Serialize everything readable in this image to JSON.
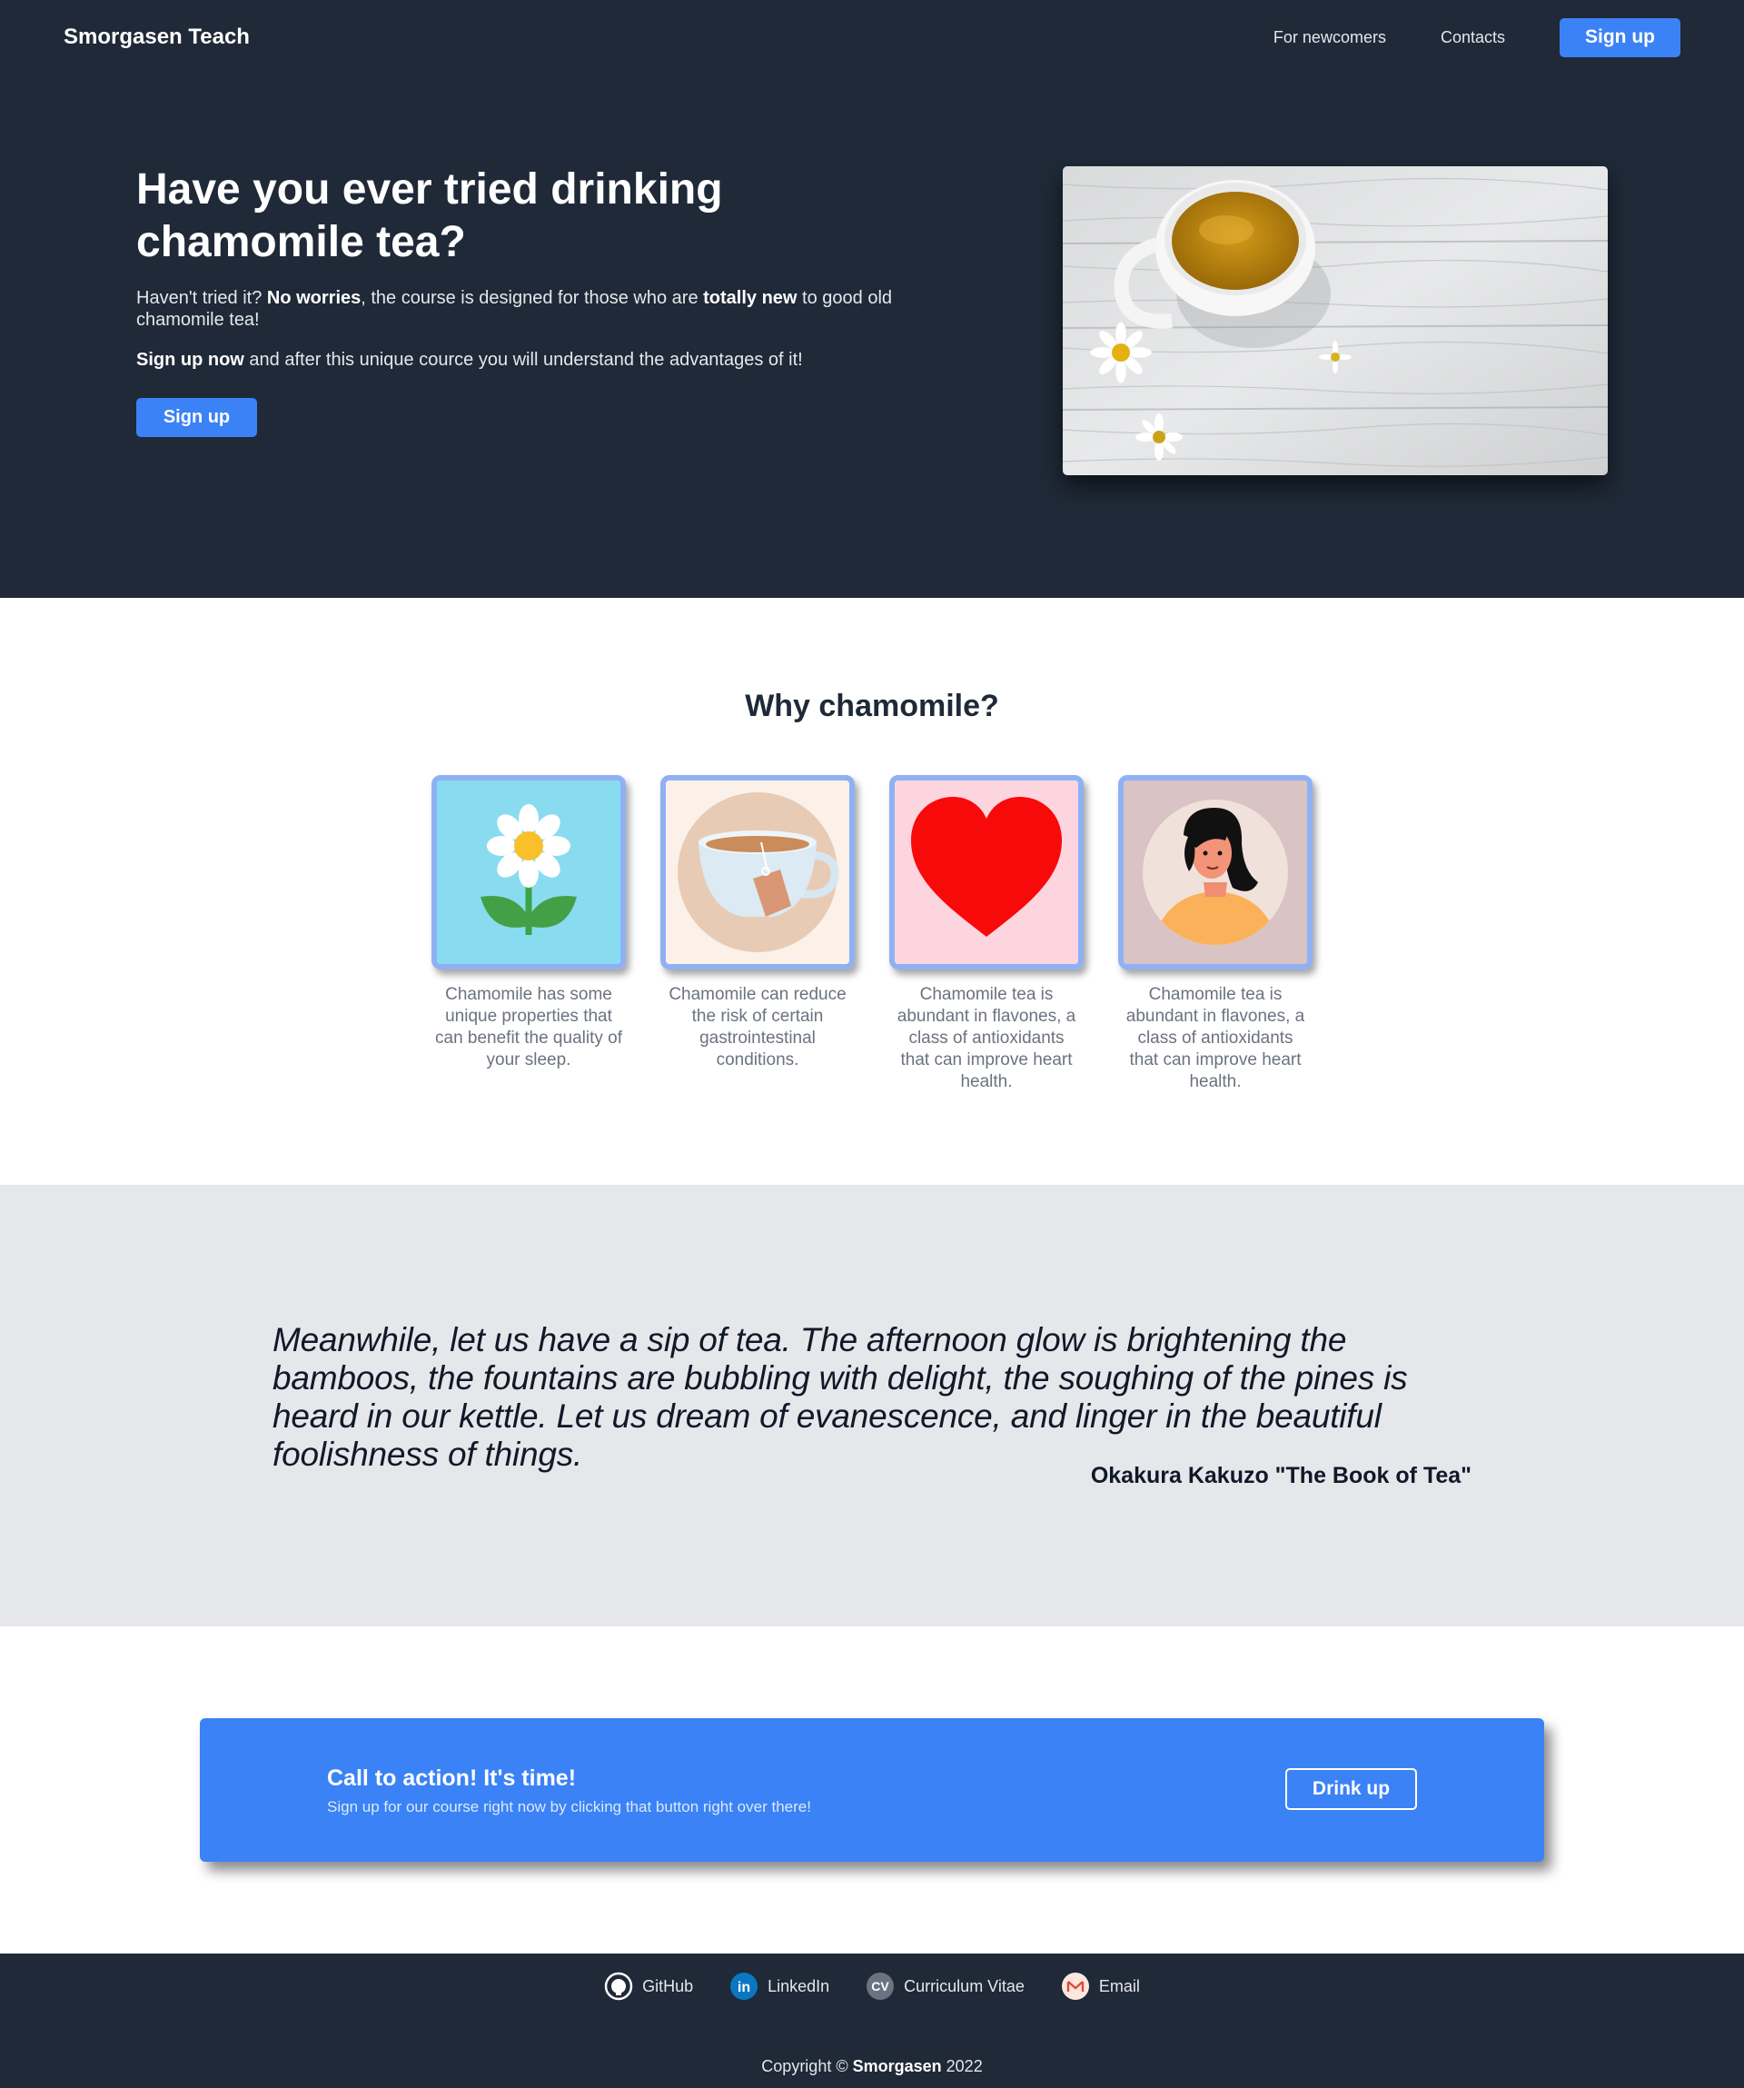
{
  "nav": {
    "brand": "Smorgasen Teach",
    "links": [
      "For newcomers",
      "Contacts"
    ],
    "signup_label": "Sign up"
  },
  "hero": {
    "title": "Have you ever tried drinking chamomile tea?",
    "p1_a": "Haven't tried it? ",
    "p1_b": "No worries",
    "p1_c": ", the course is designed for those who are ",
    "p1_d": "totally new",
    "p1_e": " to good old chamomile tea!",
    "p2_a": "Sign up now",
    "p2_b": " and after this unique cource you will understand the advantages of it!",
    "button_label": "Sign up",
    "image_icon": "chamomile-tea-cup-photo"
  },
  "why": {
    "title": "Why chamomile?",
    "cards": [
      {
        "icon": "chamomile-flower-icon",
        "text": "Chamomile has some unique properties that can benefit the quality of your sleep."
      },
      {
        "icon": "tea-cup-icon",
        "text": "Chamomile can reduce the risk of certain gastrointestinal conditions."
      },
      {
        "icon": "heart-icon",
        "text": "Chamomile tea is abundant in flavones, a class of antioxidants that can improve heart health."
      },
      {
        "icon": "woman-avatar-icon",
        "text": "Chamomile tea is abundant in flavones, a class of antioxidants that can improve heart health."
      }
    ]
  },
  "quote": {
    "text": "Meanwhile, let us have a sip of tea. The afternoon glow is brightening the bamboos, the fountains are bubbling with delight, the soughing of the pines is heard in our kettle. Let us dream of evanescence, and linger in the beautiful foolishness of things.",
    "cite": "Okakura Kakuzo \"The Book of Tea\""
  },
  "cta": {
    "title": "Call to action! It's time!",
    "text": "Sign up for our course right now by clicking that button right over there!",
    "button_label": "Drink up"
  },
  "footer": {
    "links": [
      {
        "icon": "github-icon",
        "label": "GitHub"
      },
      {
        "icon": "linkedin-icon",
        "label": "LinkedIn"
      },
      {
        "icon": "cv-icon",
        "label": "Curriculum Vitae"
      },
      {
        "icon": "email-icon",
        "label": "Email"
      }
    ],
    "copyright_prefix": "Copyright © ",
    "copyright_name": "Smorgasen",
    "copyright_year": " 2022"
  },
  "colors": {
    "dark": "#1f2937",
    "accent": "#3b82f6",
    "light_gray": "#e5e7eb"
  }
}
